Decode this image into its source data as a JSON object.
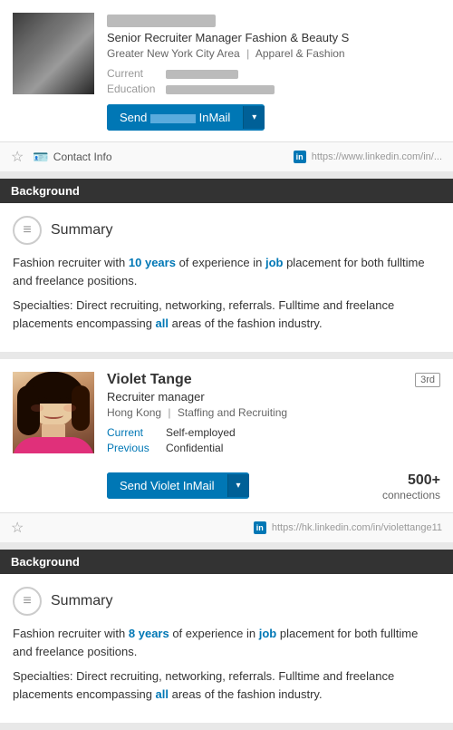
{
  "profiles": [
    {
      "id": "profile-1",
      "name_blurred": true,
      "title": "Senior Recruiter Manager Fashion & Beauty S",
      "location": "Greater New York City Area",
      "industry": "Apparel & Fashion",
      "current_label": "Current",
      "current_value_blurred": true,
      "education_label": "Education",
      "education_value_blurred": true,
      "send_btn_label": "Send",
      "inmail_label": "InMail",
      "degree": null,
      "connections": null,
      "toolbar_contact": "Contact Info",
      "toolbar_url": "https://www.linkedin.com/in/...",
      "background_label": "Background",
      "summary_heading": "Summary",
      "summary_text_1": "Fashion recruiter with 10 years of experience in job placement for both fulltime and freelance positions.",
      "summary_text_1_highlight": "10 years",
      "summary_text_1_highlight2": "job",
      "summary_text_2": "Specialties: Direct recruiting, networking, referrals. Fulltime and freelance placements encompassing all areas of the fashion industry.",
      "summary_text_2_highlight": "all"
    },
    {
      "id": "profile-2",
      "name_blurred": false,
      "name": "Violet Tange",
      "title": "Recruiter manager",
      "location": "Hong Kong",
      "industry": "Staffing and Recruiting",
      "current_label": "Current",
      "current_value": "Self-employed",
      "previous_label": "Previous",
      "previous_value": "Confidential",
      "send_btn_label": "Send Violet InMail",
      "degree": "3rd",
      "connections": "500+",
      "connections_suffix": "connections",
      "toolbar_url": "https://hk.linkedin.com/in/violettange11",
      "background_label": "Background",
      "summary_heading": "Summary",
      "summary_text_1": "Fashion recruiter with 8 years of experience in job placement for both fulltime and freelance positions.",
      "summary_text_1_highlight": "8 years",
      "summary_text_1_highlight2": "job",
      "summary_text_2": "Specialties: Direct recruiting, networking, referrals. Fulltime and freelance placements encompassing all areas of the fashion industry.",
      "summary_text_2_highlight": "all"
    }
  ]
}
